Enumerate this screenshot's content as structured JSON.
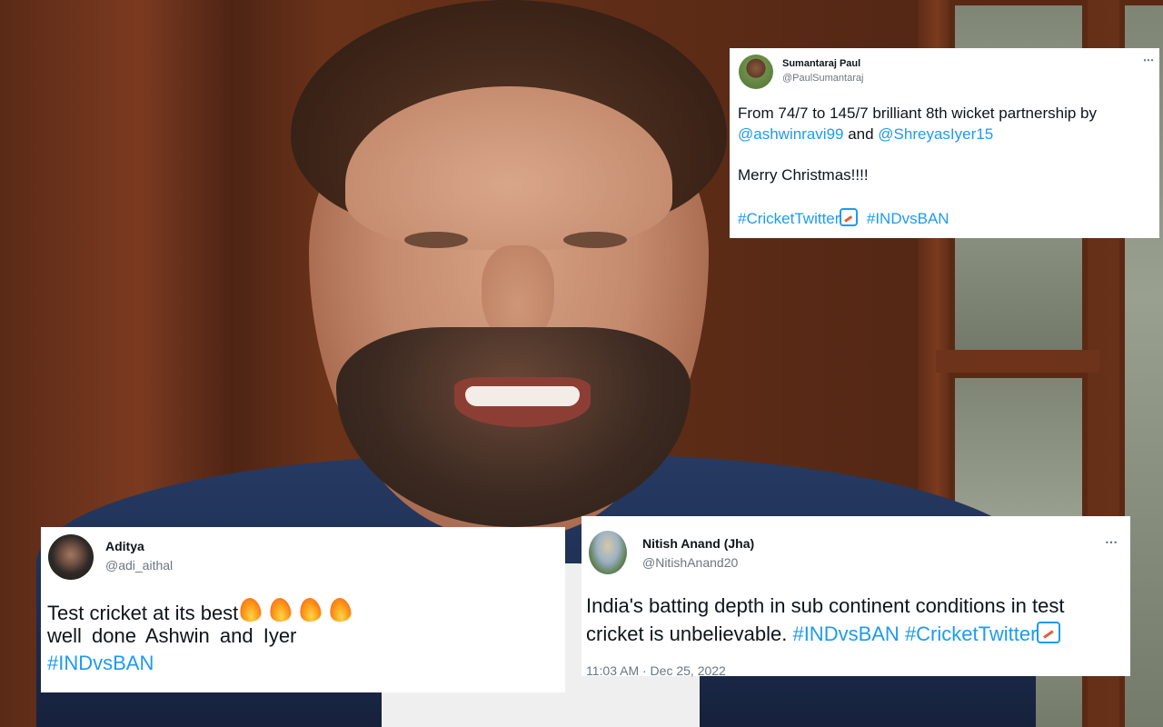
{
  "tweets": [
    {
      "name": "Sumantaraj Paul",
      "handle": "@PaulSumantaraj",
      "more_icon": "⋯",
      "line1": "From 74/7 to 145/7 brilliant 8th wicket partnership by",
      "mention1": "@ashwinravi99",
      "connector": " and ",
      "mention2": "@ShreyasIyer15",
      "line3": "Merry Christmas!!!!",
      "hashtag1": "#CricketTwitter",
      "hashtag2": "#INDvsBAN"
    },
    {
      "name": "Aditya",
      "handle": "@adi_aithal",
      "line1": "Test cricket at its best",
      "line2": "well done Ashwin and Iyer",
      "hashtag1": "#INDvsBAN"
    },
    {
      "name": "Nitish Anand (Jha)",
      "handle": "@NitishAnand20",
      "more_icon": "⋯",
      "line1": "India's batting depth in sub continent conditions in test",
      "line2_text": "cricket is unbelievable. ",
      "hashtag1": "#INDvsBAN",
      "hashtag2": "#CricketTwitter",
      "timestamp": "11:03 AM · Dec 25, 2022"
    }
  ],
  "colors": {
    "link": "#1d9bf0",
    "handle": "#6b7680",
    "card": "#ffffff"
  },
  "icons": {
    "fire": "fire-emoji-icon",
    "cricket": "cricket-bat-emoji-icon"
  }
}
